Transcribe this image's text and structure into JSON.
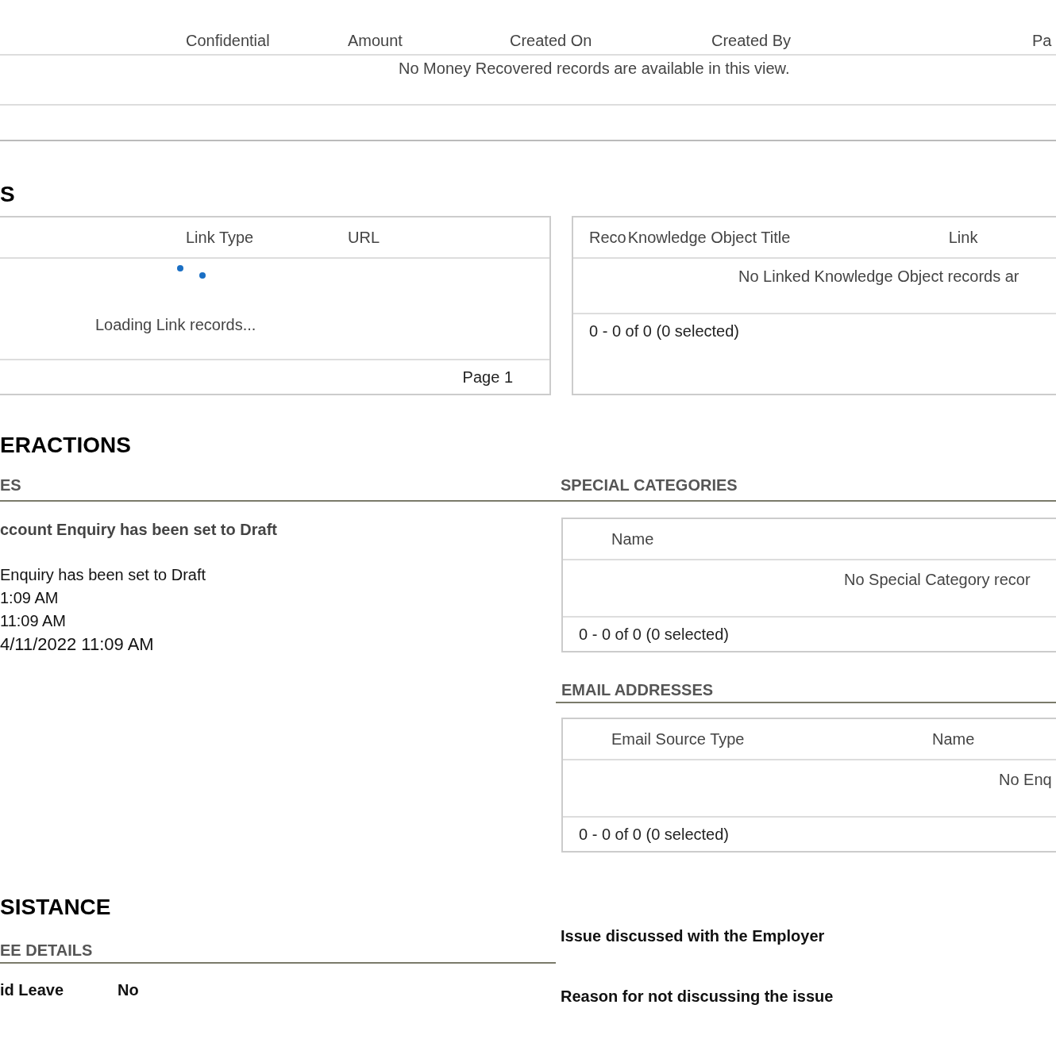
{
  "money_recovered": {
    "columns": [
      "Confidential",
      "Amount",
      "Created On",
      "Created By",
      "Pa"
    ],
    "empty_message": "No Money Recovered records are available in this view."
  },
  "links": {
    "heading": "S",
    "columns": [
      "Link Type",
      "URL"
    ],
    "loading_message": "Loading Link records...",
    "pager": "Page 1"
  },
  "knowledge_objects": {
    "columns": [
      "Reco",
      "Knowledge Object Title",
      "Link"
    ],
    "empty_message": "No Linked Knowledge Object records ar",
    "footer": "0 - 0 of 0 (0 selected)"
  },
  "interactions": {
    "heading": "ERACTIONS",
    "subheading": "ES",
    "title": "ccount Enquiry has been set to Draft",
    "lines": [
      "Enquiry has been set to Draft",
      "1:09 AM",
      "11:09 AM"
    ],
    "date": "4/11/2022 11:09 AM"
  },
  "special_categories": {
    "heading": "SPECIAL CATEGORIES",
    "columns": [
      "Name"
    ],
    "empty_message": "No Special Category recor",
    "footer": "0 - 0 of 0 (0 selected)"
  },
  "email_addresses": {
    "heading": "EMAIL ADDRESSES",
    "columns": [
      "Email Source Type",
      "Name"
    ],
    "empty_message": "No Enq",
    "footer": "0 - 0 of 0 (0 selected)"
  },
  "assistance": {
    "heading": "SISTANCE",
    "subheading": "EE DETAILS",
    "fields": [
      {
        "label": "id Leave",
        "value": "No"
      }
    ],
    "questions": [
      "Issue discussed with the Employer",
      "Reason for not discussing the issue"
    ]
  }
}
